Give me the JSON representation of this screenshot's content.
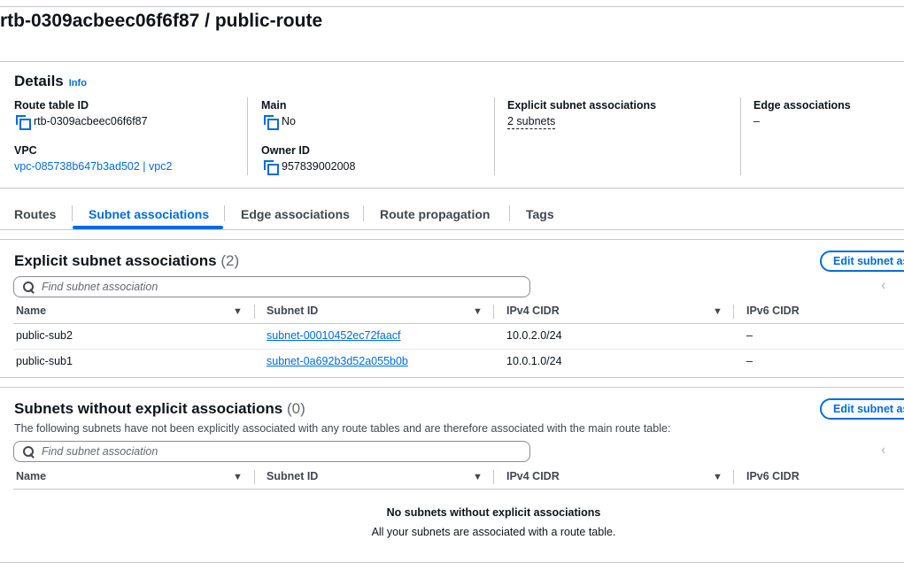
{
  "page": {
    "title": "rtb-0309acbeec06f6f87 / public-route"
  },
  "details": {
    "heading": "Details",
    "info": "Info",
    "route_table_id": {
      "label": "Route table ID",
      "value": "rtb-0309acbeec06f6f87"
    },
    "vpc": {
      "label": "VPC",
      "value": "vpc-085738b647b3ad502 | vpc2"
    },
    "main": {
      "label": "Main",
      "value": "No"
    },
    "owner_id": {
      "label": "Owner ID",
      "value": "957839002008"
    },
    "explicit_subnet_associations": {
      "label": "Explicit subnet associations",
      "value": "2 subnets"
    },
    "edge_associations": {
      "label": "Edge associations",
      "value": "–"
    }
  },
  "tabs": [
    {
      "label": "Routes",
      "active": false
    },
    {
      "label": "Subnet associations",
      "active": true
    },
    {
      "label": "Edge associations",
      "active": false
    },
    {
      "label": "Route propagation",
      "active": false
    },
    {
      "label": "Tags",
      "active": false
    }
  ],
  "explicit": {
    "title": "Explicit subnet associations",
    "count": "(2)",
    "edit_button": "Edit subnet associations",
    "search_placeholder": "Find subnet association",
    "columns": [
      "Name",
      "Subnet ID",
      "IPv4 CIDR",
      "IPv6 CIDR"
    ],
    "rows": [
      {
        "name": "public-sub2",
        "subnet_id": "subnet-00010452ec72faacf",
        "ipv4": "10.0.2.0/24",
        "ipv6": "–"
      },
      {
        "name": "public-sub1",
        "subnet_id": "subnet-0a692b3d52a055b0b",
        "ipv4": "10.0.1.0/24",
        "ipv6": "–"
      }
    ]
  },
  "without": {
    "title": "Subnets without explicit associations",
    "count": "(0)",
    "description": "The following subnets have not been explicitly associated with any route tables and are therefore associated with the main route table:",
    "edit_button": "Edit subnet associations",
    "search_placeholder": "Find subnet association",
    "columns": [
      "Name",
      "Subnet ID",
      "IPv4 CIDR",
      "IPv6 CIDR"
    ],
    "empty_title": "No subnets without explicit associations",
    "empty_subtitle": "All your subnets are associated with a route table."
  },
  "icons": {
    "copy": "copy-icon",
    "search": "search-icon",
    "sort": "caret-down-icon",
    "paginate_prev": "chevron-left-icon"
  },
  "colors": {
    "link": "#006ce0",
    "border": "#c6c6cd",
    "text": "#0f141a"
  }
}
